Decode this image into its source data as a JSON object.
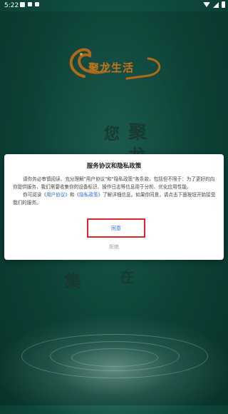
{
  "status_bar": {
    "time": "5:22"
  },
  "background": {
    "logo_text": "聚龙生活",
    "chars": [
      "聚",
      "龙",
      "您",
      "集",
      "在"
    ]
  },
  "dialog": {
    "title": "服务协议和隐私政策",
    "para1": "请你务必审慎阅读、充分理解\"用户协议\"和\"隐私政策\"各条款，包括但不限于：为了更好的向你提供服务，我们需要收集你的设备标识、操作日志等信息用于分析、优化应用性能。",
    "para2_prefix": "你可阅读",
    "user_agreement_link": "《用户协议》",
    "para2_and": "和",
    "privacy_policy_link": "《隐私政策》",
    "para2_suffix": "了解详细信息。如果你同意，请点击下面按钮开始接受我们的服务。",
    "agree_label": "同意",
    "reject_label": "拒绝"
  },
  "colors": {
    "link": "#2a6fd6",
    "highlight_border": "#e0252a",
    "background": "#0f4a3e"
  }
}
